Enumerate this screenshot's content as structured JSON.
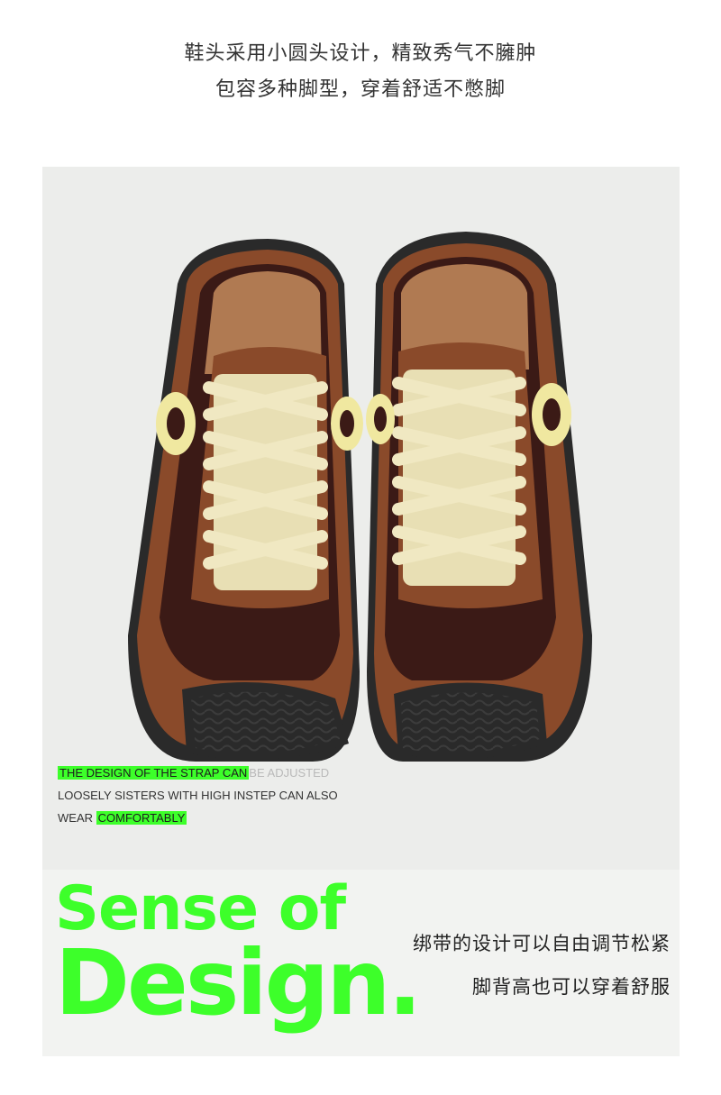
{
  "top_caption": {
    "line1": "鞋头采用小圆头设计，精致秀气不臃肿",
    "line2": "包容多种脚型，穿着舒适不憋脚"
  },
  "overlay": {
    "line1_highlight": "THE DESIGN OF THE STRAP CAN",
    "line1_faint": "BE ADJUSTED",
    "line2": "LOOSELY SISTERS WITH HIGH INSTEP CAN ALSO",
    "line3_prefix": "WEAR",
    "line3_highlight": "COMFORTABLY"
  },
  "headline": {
    "line1": "Sense of",
    "line2": "Design."
  },
  "side_caption": {
    "line1": "绑带的设计可以自由调节松紧",
    "line2": "脚背高也可以穿着舒服"
  },
  "colors": {
    "accent_green": "#3dff2a",
    "suede_brown": "#8a4a2a",
    "nylon_dark": "#3b1a16",
    "lace_cream": "#f0e8c2",
    "sole_black": "#2a2a2a"
  },
  "image": {
    "subject": "pair of brown suede sneakers with cream laces, top view"
  }
}
